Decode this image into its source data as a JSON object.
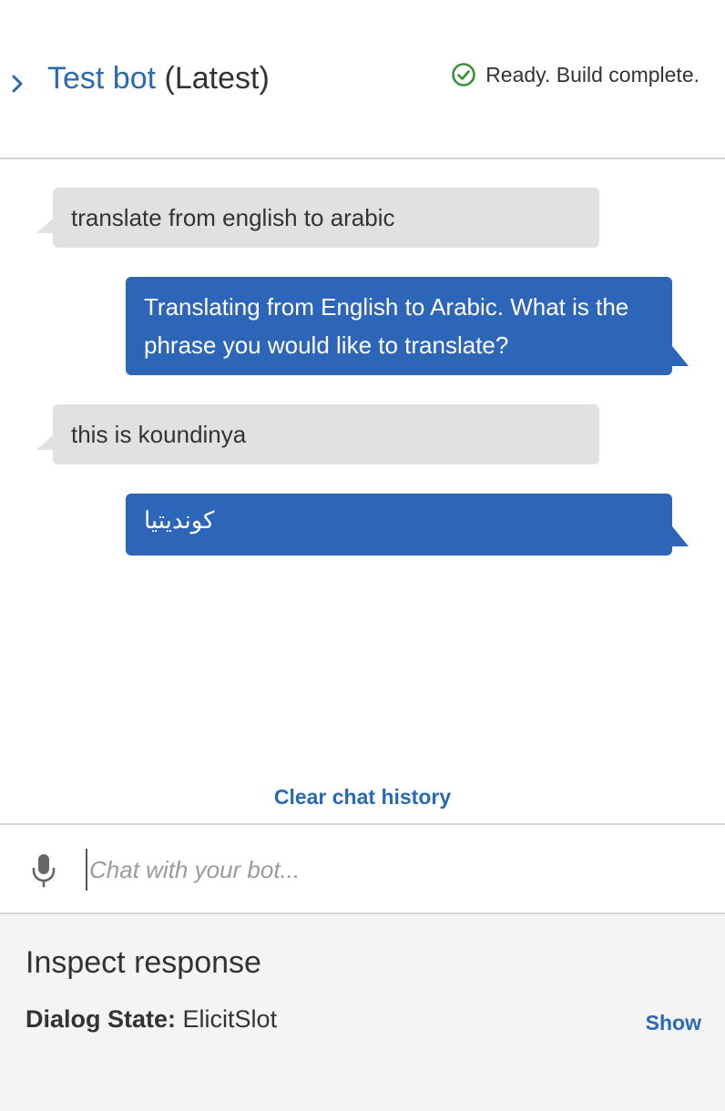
{
  "header": {
    "bot_name": "Test bot",
    "version": "(Latest)",
    "status": "Ready. Build complete.",
    "status_icon": "check-circle-icon",
    "expand_icon": "chevron-right-icon"
  },
  "messages": [
    {
      "sender": "user",
      "text": "translate from english to arabic"
    },
    {
      "sender": "bot",
      "text": "Translating from English to Arabic. What is the phrase you would like to translate?"
    },
    {
      "sender": "user",
      "text": "this is koundinya"
    },
    {
      "sender": "bot",
      "text": "كونديتيا"
    }
  ],
  "actions": {
    "clear_history": "Clear chat history"
  },
  "input": {
    "placeholder": "Chat with your bot...",
    "value": "",
    "mic_icon": "microphone-icon"
  },
  "inspect": {
    "title": "Inspect response",
    "dialog_state_label": "Dialog State:",
    "dialog_state_value": "ElicitSlot",
    "show_label": "Show"
  },
  "colors": {
    "accent": "#2a69b5",
    "bot_bubble": "#2d66b8",
    "user_bubble": "#e1e1e1",
    "status_ok": "#3a8f3a",
    "panel_bg": "#f4f4f4"
  }
}
